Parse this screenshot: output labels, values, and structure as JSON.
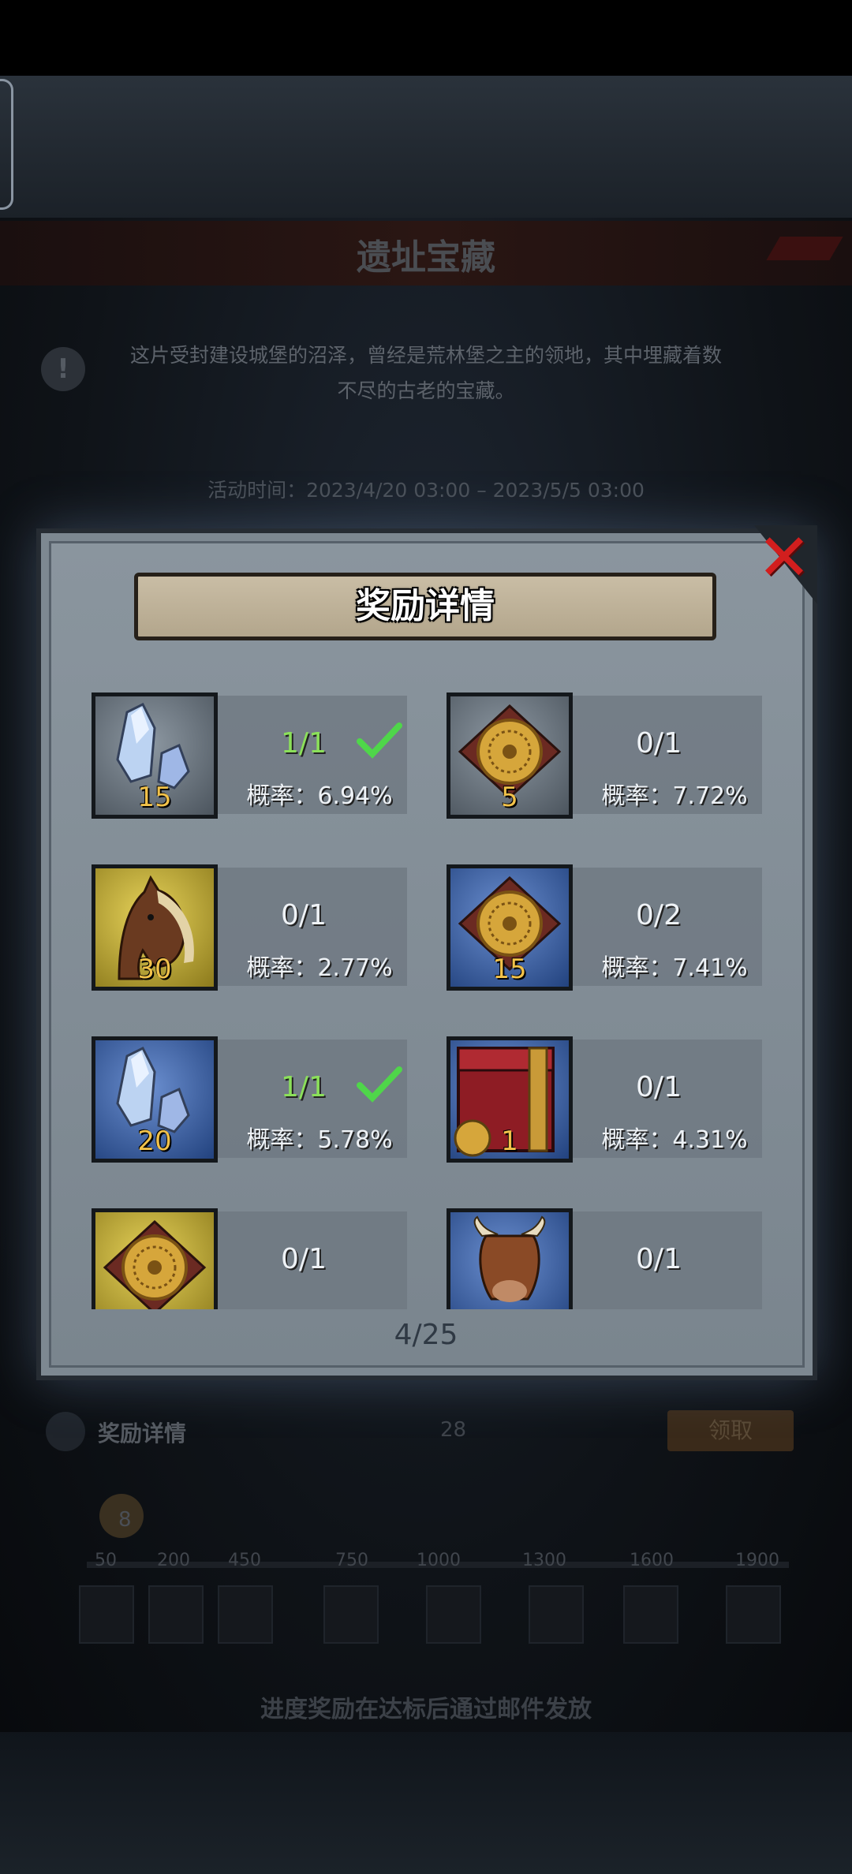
{
  "background": {
    "title": "遗址宝藏",
    "description_line1": "这片受封建设城堡的沼泽，曾经是荒林堡之主的领地，其中埋藏着数",
    "description_line2": "不尽的古老的宝藏。",
    "activity_time": "活动时间：2023/4/20 03:00 – 2023/5/5 03:00",
    "reward_details_label": "奖励详情",
    "count": "28",
    "claim_label": "领取",
    "progress_value": "8",
    "milestones": [
      "50",
      "200",
      "450",
      "750",
      "1000",
      "1300",
      "1600",
      "1900"
    ],
    "footer_note": "进度奖励在达标后通过邮件发放"
  },
  "modal": {
    "title": "奖励详情",
    "close_icon": "close-x-icon",
    "pager": "4/25",
    "items": [
      {
        "icon": "crystal-icon",
        "bg": "gray",
        "qty": "15",
        "progress": "1/1",
        "done": true,
        "rate": "概率：6.94%"
      },
      {
        "icon": "medallion-icon",
        "bg": "gray",
        "qty": "5",
        "progress": "0/1",
        "done": false,
        "rate": "概率：7.72%"
      },
      {
        "icon": "horse-icon",
        "bg": "yellow",
        "qty": "30",
        "progress": "0/1",
        "done": false,
        "rate": "概率：2.77%"
      },
      {
        "icon": "medallion-icon",
        "bg": "blue",
        "qty": "15",
        "progress": "0/2",
        "done": false,
        "rate": "概率：7.41%"
      },
      {
        "icon": "crystal-icon",
        "bg": "blue",
        "qty": "20",
        "progress": "1/1",
        "done": true,
        "rate": "概率：5.78%"
      },
      {
        "icon": "chest-icon",
        "bg": "blue",
        "qty": "1",
        "progress": "0/1",
        "done": false,
        "rate": "概率：4.31%"
      },
      {
        "icon": "medallion-icon",
        "bg": "yellow",
        "qty": "",
        "progress": "0/1",
        "done": false,
        "rate": ""
      },
      {
        "icon": "ox-icon",
        "bg": "blue",
        "qty": "",
        "progress": "0/1",
        "done": false,
        "rate": ""
      }
    ]
  }
}
